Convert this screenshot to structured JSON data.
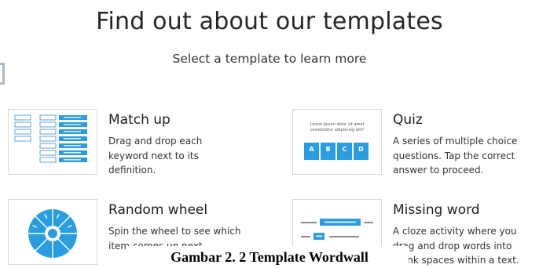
{
  "page": {
    "title": "Find out about our templates",
    "subtitle": "Select a template to learn more"
  },
  "templates": [
    {
      "title": "Match up",
      "description": "Drag and drop each keyword next to its definition."
    },
    {
      "title": "Quiz",
      "description": "A series of multiple choice questions. Tap the correct answer to proceed.",
      "thumb_question": "Lorem ipsum dolor sit amet consectetur adipiscing elit?",
      "thumb_options": [
        "A",
        "B",
        "C",
        "D"
      ]
    },
    {
      "title": "Random wheel",
      "description": "Spin the wheel to see which item comes up next."
    },
    {
      "title": "Missing word",
      "description": "A cloze activity where you drag and drop words into blank spaces within a text."
    }
  ],
  "caption": "Gambar 2. 2 Template Wordwall",
  "colors": {
    "accent": "#2a9de0",
    "thumb_border": "#d8d8d8",
    "text": "#262626"
  }
}
